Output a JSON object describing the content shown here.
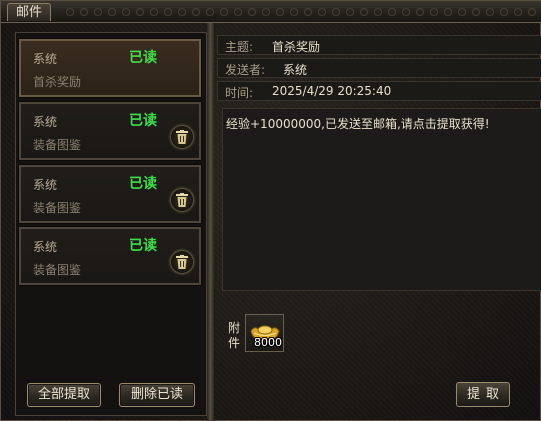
{
  "window": {
    "title": "邮件"
  },
  "mail_list": [
    {
      "sender": "系统",
      "status": "已读",
      "subject": "首杀奖励",
      "selected": true,
      "deletable": false
    },
    {
      "sender": "系统",
      "status": "已读",
      "subject": "装备图鉴",
      "selected": false,
      "deletable": true
    },
    {
      "sender": "系统",
      "status": "已读",
      "subject": "装备图鉴",
      "selected": false,
      "deletable": true
    },
    {
      "sender": "系统",
      "status": "已读",
      "subject": "装备图鉴",
      "selected": false,
      "deletable": true
    }
  ],
  "buttons": {
    "claim_all": "全部提取",
    "delete_read": "删除已读",
    "claim": "提取"
  },
  "detail": {
    "subject_label": "主题:",
    "subject": "首杀奖励",
    "sender_label": "发送者:",
    "sender": "系统",
    "time_label": "时间:",
    "time": "2025/4/29 20:25:40",
    "body": "经验+10000000,已发送至邮箱,请点击提取获得!"
  },
  "attachment": {
    "label": "附件",
    "icon": "gold-ingot-icon",
    "quantity": "8000"
  },
  "colors": {
    "read_status": "#3ee04a",
    "text": "#e8e0cc",
    "frame": "#6b604f"
  }
}
